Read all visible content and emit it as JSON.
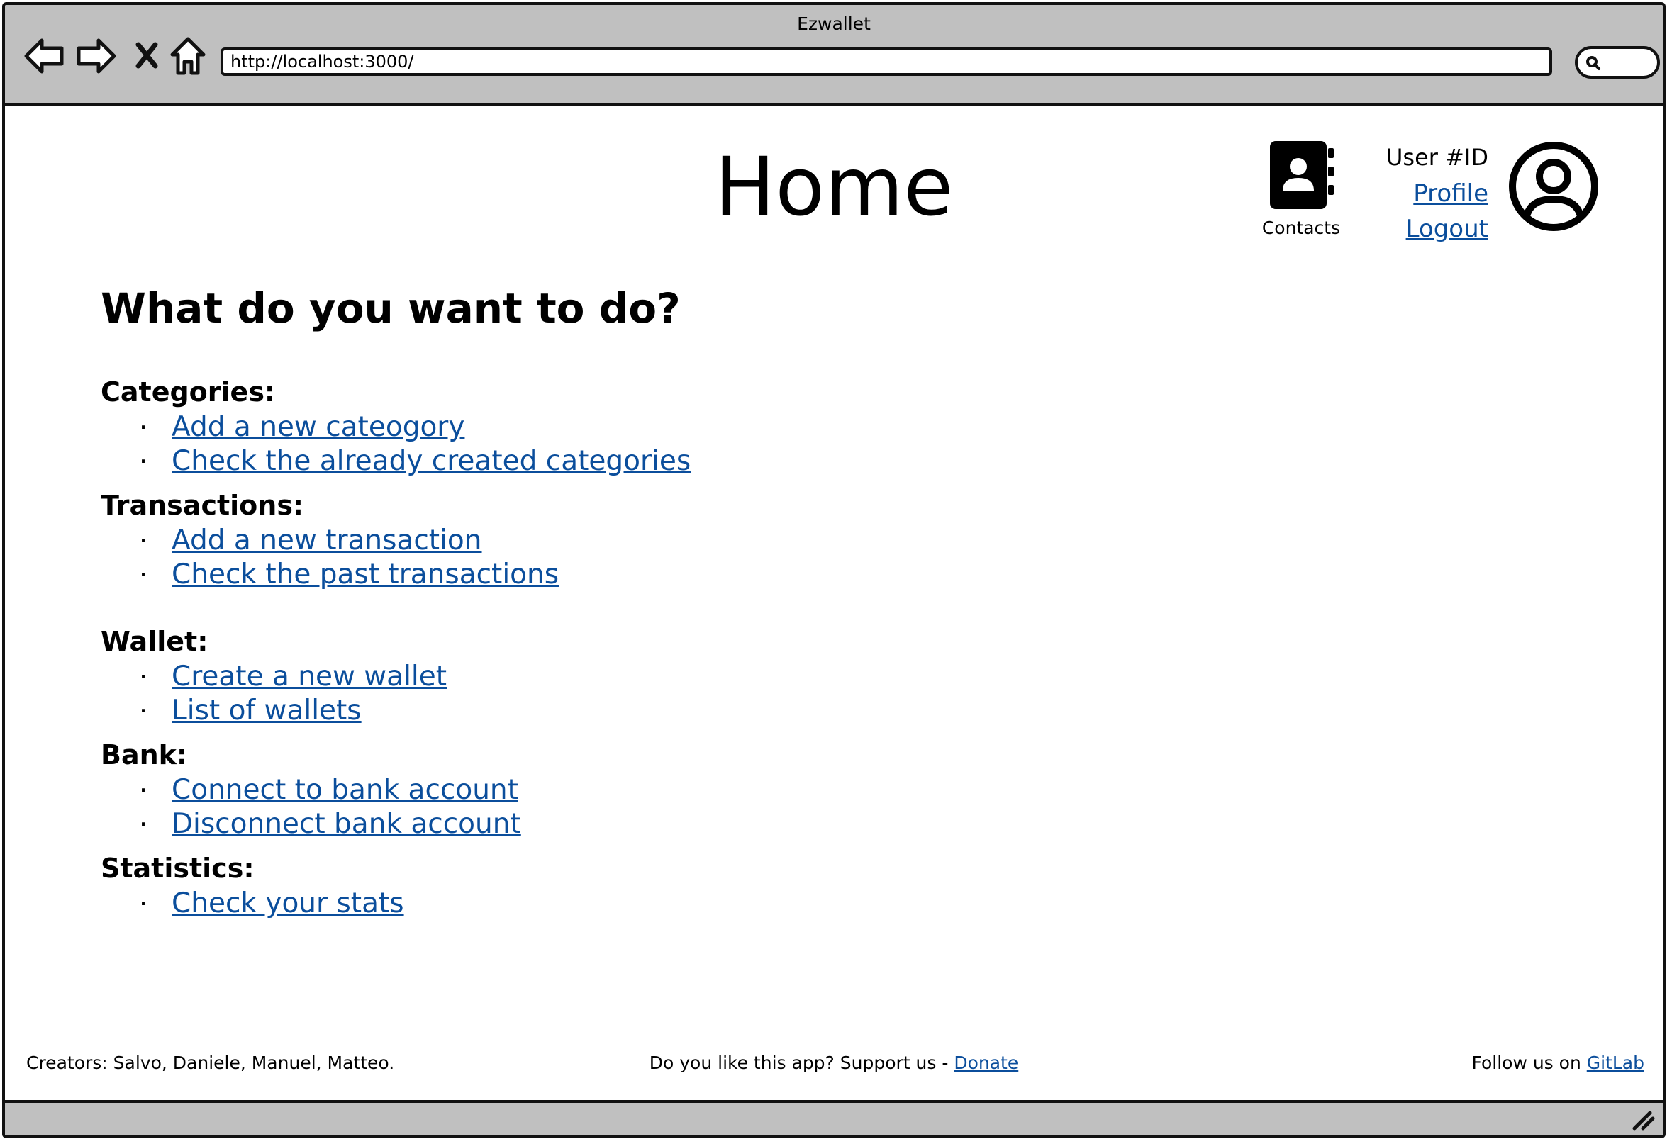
{
  "browser": {
    "window_title": "Ezwallet",
    "url": "http://localhost:3000/"
  },
  "header": {
    "title": "Home",
    "contacts_label": "Contacts",
    "user_id": "User #ID",
    "profile_link": "Profile",
    "logout_link": "Logout"
  },
  "main": {
    "question": "What do you want to do?",
    "sections": [
      {
        "title": "Categories:",
        "links": [
          "Add a new cateogory",
          "Check the already created categories"
        ]
      },
      {
        "title": "Transactions:",
        "links": [
          "Add a new transaction",
          "Check the past transactions"
        ]
      },
      {
        "title": "Wallet:",
        "links": [
          "Create a new wallet",
          "List of wallets"
        ]
      },
      {
        "title": "Bank:",
        "links": [
          "Connect to bank account",
          "Disconnect bank account"
        ]
      },
      {
        "title": "Statistics:",
        "links": [
          "Check your stats"
        ]
      }
    ]
  },
  "footer": {
    "creators": "Creators: Salvo, Daniele, Manuel, Matteo.",
    "support_text": "Do you like this app? Support us - ",
    "donate_link": "Donate",
    "follow_text": "Follow us on ",
    "gitlab_link": "GitLab"
  },
  "colors": {
    "link": "#0b4e9c",
    "chrome": "#c0c0c0"
  }
}
